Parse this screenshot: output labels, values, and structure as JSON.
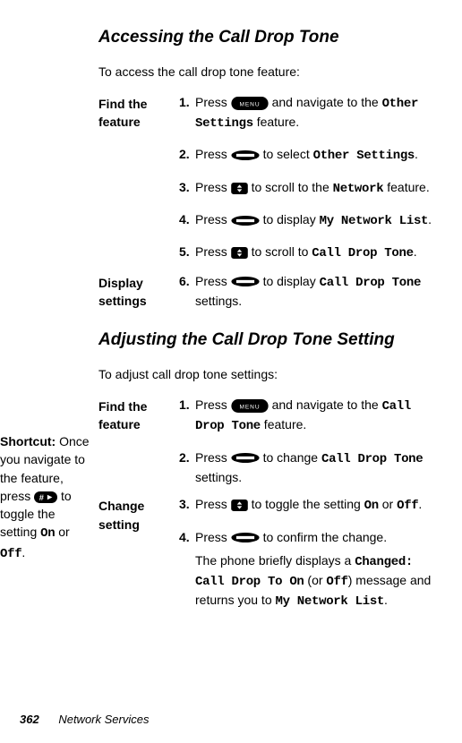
{
  "section1": {
    "heading": "Accessing the Call Drop Tone",
    "intro": "To access the call drop tone feature:",
    "block1_label": "Find the feature",
    "steps": [
      {
        "n": "1.",
        "pre": "Press ",
        "icon": "menu",
        "mid": " and navigate to the ",
        "mono": "Other Settings",
        "post": " feature."
      },
      {
        "n": "2.",
        "pre": "Press ",
        "icon": "select",
        "mid": " to select ",
        "mono": "Other Settings",
        "post": "."
      },
      {
        "n": "3.",
        "pre": "Press ",
        "icon": "scroll",
        "mid": " to scroll to the ",
        "mono": "Network",
        "post": " feature."
      },
      {
        "n": "4.",
        "pre": "Press ",
        "icon": "select",
        "mid": " to display ",
        "mono": "My Network List",
        "post": "."
      },
      {
        "n": "5.",
        "pre": "Press ",
        "icon": "scroll",
        "mid": " to scroll to ",
        "mono": "Call Drop Tone",
        "post": "."
      }
    ],
    "block2_label": "Display settings",
    "step6": {
      "n": "6.",
      "pre": "Press ",
      "icon": "select",
      "mid": " to display ",
      "mono": "Call Drop Tone",
      "post": " settings."
    }
  },
  "section2": {
    "heading": "Adjusting the Call Drop Tone Setting",
    "intro": "To adjust call drop tone settings:",
    "block1_label": "Find the feature",
    "steps1": [
      {
        "n": "1.",
        "pre": "Press ",
        "icon": "menu",
        "mid": " and navigate to the ",
        "mono": "Call Drop Tone",
        "post": " feature."
      },
      {
        "n": "2.",
        "pre": "Press ",
        "icon": "select",
        "mid": " to change ",
        "mono": "Call Drop Tone",
        "post": " settings."
      }
    ],
    "block2_label": "Change setting",
    "step3": {
      "n": "3.",
      "pre": "Press ",
      "icon": "scroll",
      "mid": " to toggle the setting ",
      "mono": "On",
      "mid2": " or ",
      "mono2": "Off",
      "post": "."
    },
    "step4": {
      "n": "4.",
      "pre": "Press ",
      "icon": "select",
      "mid": " to confirm the change.",
      "sub_pre": "The phone briefly displays a ",
      "sub_m1": "Changed: Call Drop To On",
      "sub_mid": " (or ",
      "sub_m2": "Off",
      "sub_mid2": ") message and returns you to ",
      "sub_m3": "My Network List",
      "sub_post": "."
    }
  },
  "shortcut": {
    "label": "Shortcut:",
    "t1": " Once you navigate to the feature, press ",
    "t2": " to toggle the setting ",
    "m1": "On",
    "t3": " or ",
    "m2": "Off",
    "t4": "."
  },
  "footer": {
    "page": "362",
    "section": "Network Services"
  }
}
